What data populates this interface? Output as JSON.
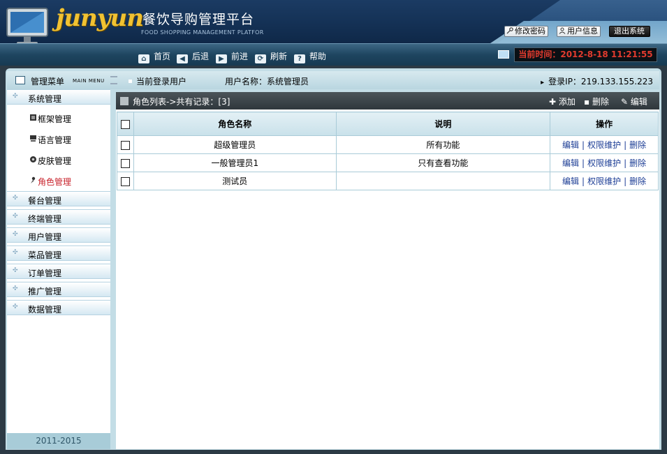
{
  "header": {
    "brand": "junyun",
    "title": "餐饮导购管理平台",
    "subtitle": "FOOD SHOPPING MANAGEMENT PLATFOR",
    "buttons": {
      "change_password": "修改密码",
      "user_info": "用户信息",
      "logout": "退出系统"
    }
  },
  "toolbar": {
    "home": "首页",
    "back": "后退",
    "forward": "前进",
    "refresh": "刷新",
    "help": "帮助",
    "clock": "当前时间：2012-8-18 11:21:55"
  },
  "subbar": {
    "menu_title": "管理菜单",
    "menu_subtitle": "MAIN MENU",
    "current_user": "当前登录用户",
    "user_name": "用户名称：系统管理员",
    "login_ip": "登录IP：219.133.155.223"
  },
  "sidebar": {
    "groups": [
      {
        "label": "系统管理"
      },
      {
        "label": "餐台管理"
      },
      {
        "label": "终端管理"
      },
      {
        "label": "用户管理"
      },
      {
        "label": "菜品管理"
      },
      {
        "label": "订单管理"
      },
      {
        "label": "推广管理"
      },
      {
        "label": "数据管理"
      }
    ],
    "system_items": [
      {
        "label": "框架管理",
        "icon": "frame-icon"
      },
      {
        "label": "语言管理",
        "icon": "language-icon"
      },
      {
        "label": "皮肤管理",
        "icon": "skin-icon"
      },
      {
        "label": "角色管理",
        "icon": "role-icon",
        "active": true
      }
    ],
    "copyright": "2011-2015"
  },
  "content": {
    "list_title": "角色列表->共有记录：[3]",
    "actions": {
      "add": "添加",
      "delete": "删除",
      "edit": "编辑"
    },
    "columns": {
      "name": "角色名称",
      "desc": "说明",
      "ops": "操作"
    },
    "rows": [
      {
        "name": "超级管理员",
        "desc": "所有功能"
      },
      {
        "name": "一般管理员1",
        "desc": "只有查看功能"
      },
      {
        "name": "测试员",
        "desc": ""
      }
    ],
    "row_ops": {
      "edit": "编辑",
      "perm": "权限维护",
      "delete": "删除",
      "sep": "|"
    }
  },
  "colors": {
    "header_bg": "#143155",
    "brand_yellow": "#f1c232",
    "clock_red": "#e23b2e",
    "active_item": "#c8232c",
    "link": "#1c3d95"
  }
}
